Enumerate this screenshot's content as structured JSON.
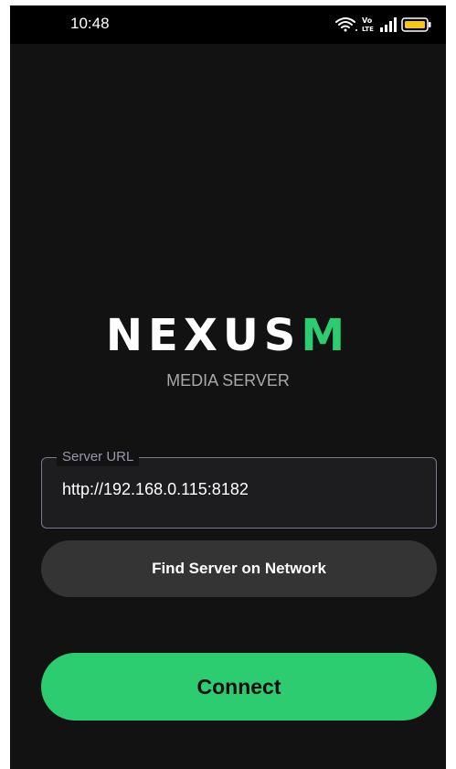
{
  "status_bar": {
    "time": "10:48",
    "icons": [
      "wifi-icon",
      "volte-icon",
      "signal-icon",
      "battery-icon"
    ],
    "battery_color": "#f5c518",
    "volte_text": "Vo LTE"
  },
  "brand": {
    "logo_main": "NEXUS",
    "logo_accent": "M",
    "subtitle": "MEDIA SERVER",
    "accent_color": "#2ecc71"
  },
  "form": {
    "server_url_label": "Server URL",
    "server_url_value": "http://192.168.0.115:8182",
    "find_button_label": "Find Server on Network",
    "connect_button_label": "Connect"
  }
}
